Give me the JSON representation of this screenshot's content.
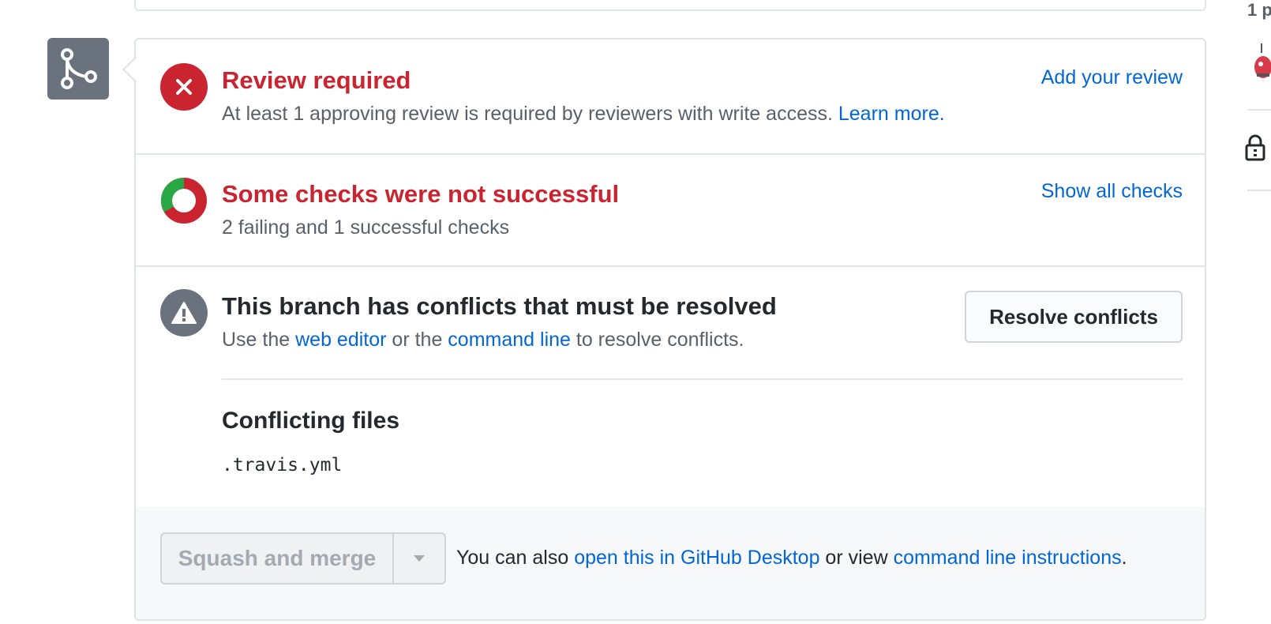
{
  "review": {
    "title": "Review required",
    "description": "At least 1 approving review is required by reviewers with write access. ",
    "learn_more": "Learn more.",
    "action": "Add your review"
  },
  "checks": {
    "title": "Some checks were not successful",
    "description": "2 failing and 1 successful checks",
    "action": "Show all checks",
    "failing": 2,
    "successful": 1
  },
  "conflicts": {
    "title": "This branch has conflicts that must be resolved",
    "desc_prefix": "Use the ",
    "web_editor": "web editor",
    "desc_mid": " or the ",
    "command_line": "command line",
    "desc_suffix": " to resolve conflicts.",
    "button": "Resolve conflicts",
    "files_title": "Conflicting files",
    "files": [
      ".travis.yml"
    ]
  },
  "merge": {
    "button": "Squash and merge",
    "text_prefix": "You can also ",
    "desktop_link": "open this in GitHub Desktop",
    "text_mid": " or view ",
    "cli_link": "command line instructions",
    "text_suffix": "."
  },
  "sidebar": {
    "participants_text": "1 p"
  },
  "icons": {
    "merge_avatar": "git-merge-icon",
    "review": "x-circle-icon",
    "checks": "donut-status-icon",
    "conflicts": "alert-icon",
    "caret": "triangle-down-icon",
    "lock": "lock-icon"
  },
  "colors": {
    "danger": "#cb2431",
    "success": "#28a745",
    "link": "#0366d6",
    "neutral": "#6a737d"
  }
}
